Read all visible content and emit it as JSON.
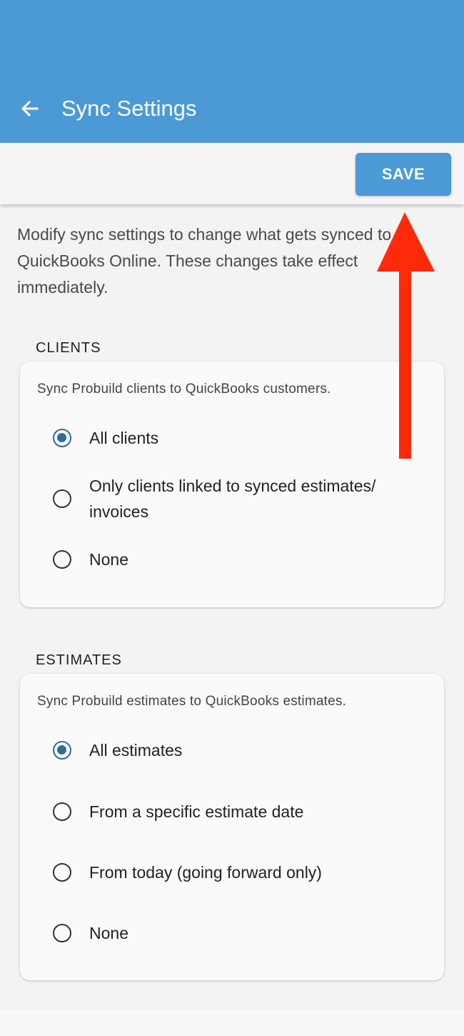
{
  "header": {
    "title": "Sync Settings",
    "back_icon": "arrow-left-icon",
    "background_color": "#4b9ad6"
  },
  "toolbar": {
    "save_label": "SAVE"
  },
  "intro": {
    "text": "Modify sync settings to change what gets synced to QuickBooks Online. These changes take effect immediately."
  },
  "clients": {
    "heading": "CLIENTS",
    "description": "Sync Probuild clients to QuickBooks customers.",
    "options": [
      {
        "label": "All clients",
        "checked": true
      },
      {
        "label": "Only clients linked to synced estimates/ invoices",
        "checked": false
      },
      {
        "label": "None",
        "checked": false
      }
    ]
  },
  "estimates": {
    "heading": "ESTIMATES",
    "description": "Sync Probuild estimates to QuickBooks estimates.",
    "options": [
      {
        "label": "All estimates",
        "checked": true
      },
      {
        "label": "From a specific estimate date",
        "checked": false
      },
      {
        "label": "From today (going forward only)",
        "checked": false
      },
      {
        "label": "None",
        "checked": false
      }
    ]
  },
  "annotation": {
    "arrow_color": "#ff2a0a"
  }
}
